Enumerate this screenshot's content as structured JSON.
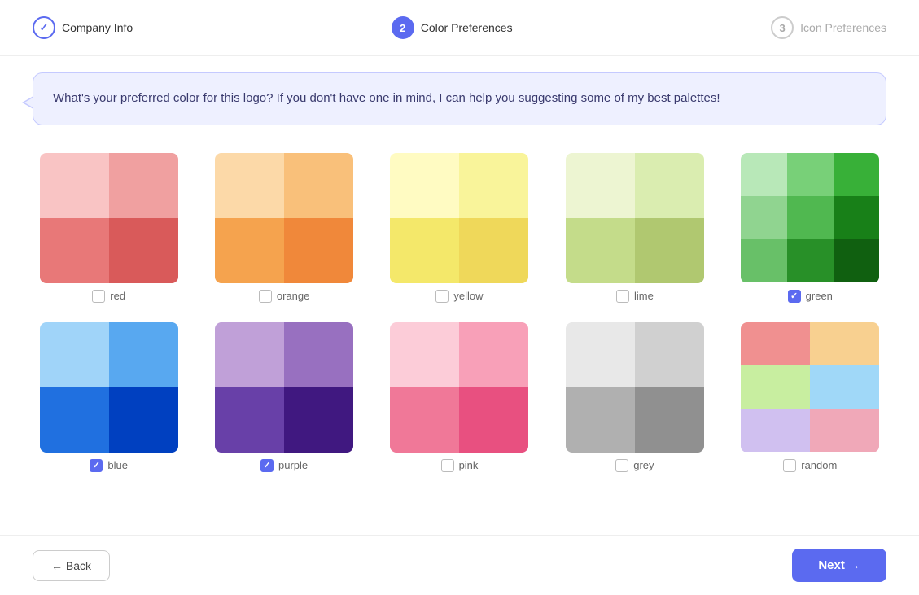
{
  "stepper": {
    "steps": [
      {
        "id": "company-info",
        "number": "✓",
        "label": "Company Info",
        "state": "completed"
      },
      {
        "id": "color-preferences",
        "number": "2",
        "label": "Color Preferences",
        "state": "active"
      },
      {
        "id": "icon-preferences",
        "number": "3",
        "label": "Icon Preferences",
        "state": "inactive"
      }
    ]
  },
  "chatBubble": {
    "text": "What's your preferred color for this logo? If you don't have one in mind, I can help you suggesting some of my best palettes!"
  },
  "colors": [
    {
      "id": "red",
      "label": "red",
      "checked": false,
      "swatches": [
        "#f9c4c4",
        "#f0a0a0",
        "#e87878",
        "#d95a5a"
      ]
    },
    {
      "id": "orange",
      "label": "orange",
      "checked": false,
      "swatches": [
        "#fcd9a8",
        "#f9c07a",
        "#f5a34e",
        "#f0883a"
      ]
    },
    {
      "id": "yellow",
      "label": "yellow",
      "checked": false,
      "swatches": [
        "#fffbc2",
        "#f9f49a",
        "#f4e86a",
        "#efd85a"
      ]
    },
    {
      "id": "lime",
      "label": "lime",
      "checked": false,
      "swatches": [
        "#edf5d2",
        "#daedb0",
        "#c4dc8a",
        "#b0c870"
      ]
    },
    {
      "id": "green",
      "label": "green",
      "checked": true,
      "swatches": [
        "#b8e0b8",
        "#70c070",
        "#3aaa3a",
        "#207020"
      ]
    },
    {
      "id": "blue",
      "label": "blue",
      "checked": true,
      "swatches": [
        "#a0d4f9",
        "#58a8f0",
        "#2070e0",
        "#0040c0"
      ]
    },
    {
      "id": "purple",
      "label": "purple",
      "checked": true,
      "swatches": [
        "#c0a0d8",
        "#9870c0",
        "#6840a8",
        "#401880"
      ]
    },
    {
      "id": "pink",
      "label": "pink",
      "checked": false,
      "swatches": [
        "#fcccd8",
        "#f8a0b8",
        "#f07898",
        "#e85080"
      ]
    },
    {
      "id": "grey",
      "label": "grey",
      "checked": false,
      "swatches": [
        "#e8e8e8",
        "#d0d0d0",
        "#b0b0b0",
        "#909090"
      ]
    },
    {
      "id": "random",
      "label": "random",
      "checked": false,
      "swatches": [
        "#f09090",
        "#f8d090",
        "#c8f0a0",
        "#90c8f8"
      ]
    }
  ],
  "footer": {
    "back_label": "← Back",
    "next_label": "Next →"
  }
}
